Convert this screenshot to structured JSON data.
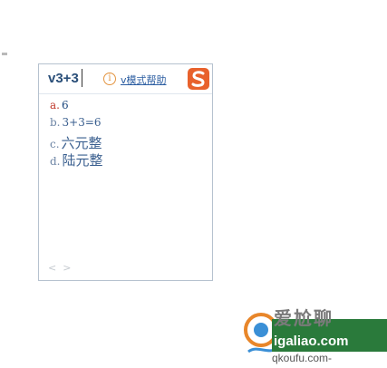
{
  "ime": {
    "input_text": "v3+3",
    "help_label": "v模式帮助",
    "help_icon": "info-icon",
    "logo_icon": "sogou-s-logo",
    "logo_color": "#e8612c",
    "candidates": [
      {
        "index": "a.",
        "value": "6"
      },
      {
        "index": "b.",
        "value": "3+3=6"
      },
      {
        "index": "c.",
        "value": "六元整"
      },
      {
        "index": "d.",
        "value": "陆元整"
      }
    ],
    "prev_page": "<",
    "next_page": ">"
  },
  "watermark": {
    "chinese_text": "爱尬聊",
    "url": "igaliao.com",
    "sub_url": "qkoufu.com-"
  }
}
